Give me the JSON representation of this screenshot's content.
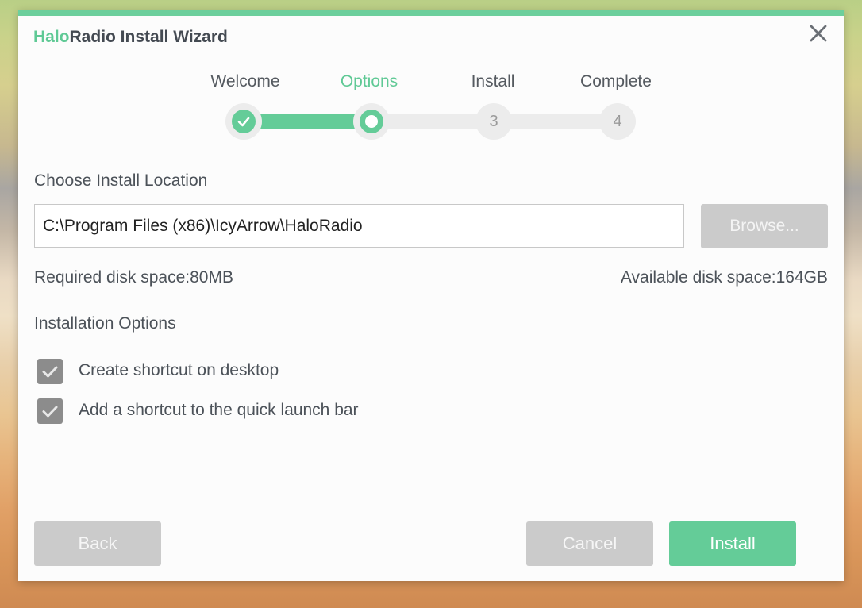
{
  "window": {
    "title_accent": "Halo",
    "title_rest": "Radio Install Wizard"
  },
  "icons": {
    "close": "close-icon",
    "check": "check-icon"
  },
  "colors": {
    "accent": "#64cc98",
    "disabled": "#cbcbcb",
    "text": "#4c5259"
  },
  "steps": [
    {
      "label": "Welcome",
      "state": "done",
      "number": ""
    },
    {
      "label": "Options",
      "state": "current",
      "number": ""
    },
    {
      "label": "Install",
      "state": "pending",
      "number": "3"
    },
    {
      "label": "Complete",
      "state": "pending",
      "number": "4"
    }
  ],
  "location": {
    "heading": "Choose Install Location",
    "path_value": "C:\\Program Files (x86)\\IcyArrow\\HaloRadio",
    "browse_label": "Browse..."
  },
  "disk": {
    "required": "Required disk space:80MB",
    "available": "Available disk space:164GB"
  },
  "options": {
    "heading": "Installation Options",
    "items": [
      {
        "label": "Create shortcut on desktop",
        "checked": true
      },
      {
        "label": "Add a shortcut to the quick launch bar",
        "checked": true
      }
    ]
  },
  "footer": {
    "back_label": "Back",
    "cancel_label": "Cancel",
    "install_label": "Install"
  }
}
